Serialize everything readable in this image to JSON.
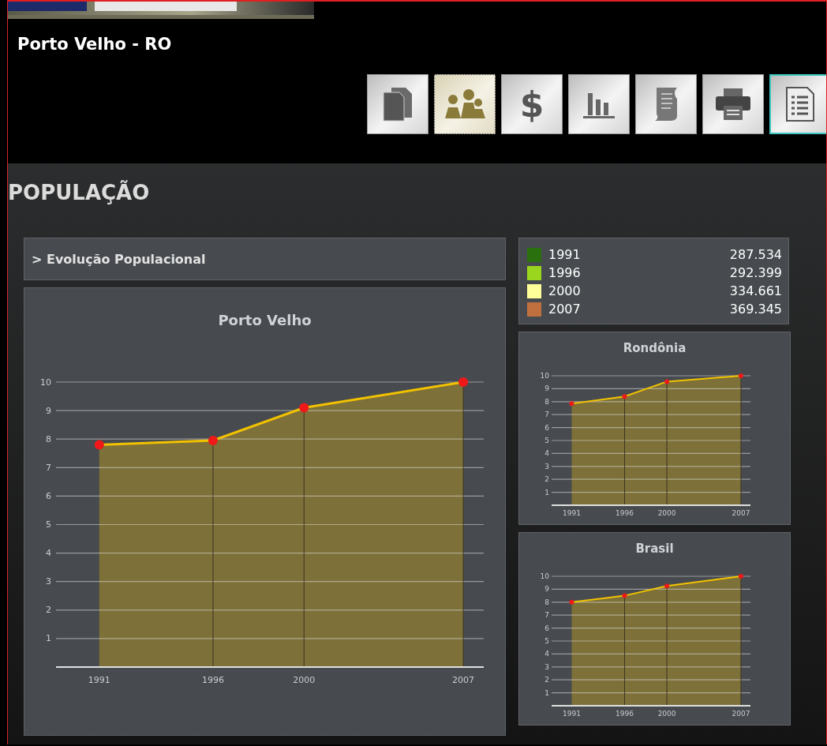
{
  "header": {
    "place": "Porto Velho - RO"
  },
  "toolbar": [
    {
      "kind": "documents",
      "selected": false,
      "focused": false
    },
    {
      "kind": "people",
      "selected": true,
      "focused": false
    },
    {
      "kind": "currency",
      "label": "$",
      "selected": false,
      "focused": false
    },
    {
      "kind": "barchart",
      "selected": false,
      "focused": false
    },
    {
      "kind": "scroll",
      "selected": false,
      "focused": false
    },
    {
      "kind": "printer",
      "selected": false,
      "focused": false
    },
    {
      "kind": "list",
      "selected": false,
      "focused": true
    }
  ],
  "section_title": "POPULAÇÃO",
  "panel_header": "> Evolução Populacional",
  "main_chart": {
    "chart_data": {
      "type": "area",
      "title": "Porto Velho",
      "x": [
        1991,
        1996,
        2000,
        2007
      ],
      "grid": true,
      "series": [
        {
          "color": "#7d7038",
          "values": [
            7.8,
            7.95,
            9.1,
            10
          ]
        }
      ],
      "xlim": [
        1989.1,
        2007.9
      ],
      "ylim": [
        0,
        10
      ],
      "xticks": [
        1991,
        1996,
        2000,
        2007
      ],
      "yticks": [
        1,
        2,
        3,
        4,
        5,
        6,
        7,
        8,
        9,
        10
      ]
    }
  },
  "legend": [
    {
      "year": "1991",
      "value": "287.534",
      "color": "#2b700f"
    },
    {
      "year": "1996",
      "value": "292.399",
      "color": "#9ad61e"
    },
    {
      "year": "2000",
      "value": "334.661",
      "color": "#fffe98"
    },
    {
      "year": "2007",
      "value": "369.345",
      "color": "#c0703f"
    }
  ],
  "regional_charts": [
    {
      "chart_data": {
        "type": "area",
        "title": "Rondônia",
        "x": [
          1991,
          1996,
          2000,
          2007
        ],
        "grid": true,
        "series": [
          {
            "color": "#7d7038",
            "values": [
              7.85,
              8.4,
              9.55,
              10
            ]
          }
        ],
        "xlim": [
          1989.1,
          2007.9
        ],
        "ylim": [
          0,
          10
        ],
        "xticks": [
          1991,
          1996,
          2000,
          2007
        ],
        "yticks": [
          1,
          2,
          3,
          4,
          5,
          6,
          7,
          8,
          9,
          10
        ]
      }
    },
    {
      "chart_data": {
        "type": "area",
        "title": "Brasil",
        "x": [
          1991,
          1996,
          2000,
          2007
        ],
        "grid": true,
        "series": [
          {
            "color": "#7d7038",
            "values": [
              8.0,
              8.5,
              9.25,
              10
            ]
          }
        ],
        "xlim": [
          1989.1,
          2007.9
        ],
        "ylim": [
          0,
          10
        ],
        "xticks": [
          1991,
          1996,
          2000,
          2007
        ],
        "yticks": [
          1,
          2,
          3,
          4,
          5,
          6,
          7,
          8,
          9,
          10
        ]
      }
    }
  ]
}
